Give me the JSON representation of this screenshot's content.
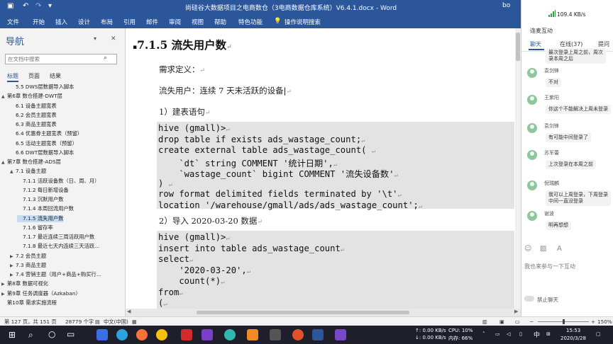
{
  "window": {
    "title": "尚硅谷大数据项目之电商数仓（3电商数据仓库系统）V6.4.1.docx  -  Word",
    "user": "bo"
  },
  "ribbon": {
    "tabs": [
      "文件",
      "开始",
      "插入",
      "设计",
      "布局",
      "引用",
      "邮件",
      "审阅",
      "视图",
      "帮助",
      "特色功能",
      "操作说明搜索"
    ]
  },
  "nav": {
    "title": "导航",
    "search_placeholder": "在文档中搜索",
    "tabs": [
      "标题",
      "页面",
      "结果"
    ],
    "items": [
      {
        "label": "5.5 DWS层数据导入脚本",
        "level": 2,
        "expand": ""
      },
      {
        "label": "第6章 数仓搭建-DWT层",
        "level": 1,
        "expand": "▲"
      },
      {
        "label": "6.1 设备主题宽表",
        "level": 2,
        "expand": ""
      },
      {
        "label": "6.2 会员主题宽表",
        "level": 2,
        "expand": ""
      },
      {
        "label": "6.3 商品主题宽表",
        "level": 2,
        "expand": ""
      },
      {
        "label": "6.4 优惠券主题宽表（预留）",
        "level": 2,
        "expand": ""
      },
      {
        "label": "6.5 活动主题宽表（预留）",
        "level": 2,
        "expand": ""
      },
      {
        "label": "6.6 DWT层数据导入脚本",
        "level": 2,
        "expand": ""
      },
      {
        "label": "第7章 数仓搭建-ADS层",
        "level": 1,
        "expand": "▲"
      },
      {
        "label": "7.1 设备主题",
        "level": 2,
        "expand": "▲"
      },
      {
        "label": "7.1.1 活跃设备数（日、周、月）",
        "level": 3,
        "expand": ""
      },
      {
        "label": "7.1.2 每日新增设备",
        "level": 3,
        "expand": ""
      },
      {
        "label": "7.1.3 沉默用户数",
        "level": 3,
        "expand": ""
      },
      {
        "label": "7.1.4 本周回流用户数",
        "level": 3,
        "expand": ""
      },
      {
        "label": "7.1.5 流失用户数",
        "level": 3,
        "expand": "",
        "selected": true
      },
      {
        "label": "7.1.6 留存率",
        "level": 3,
        "expand": ""
      },
      {
        "label": "7.1.7 最近连续三周活跃用户数",
        "level": 3,
        "expand": ""
      },
      {
        "label": "7.1.8 最近七天内连续三天活跃...",
        "level": 3,
        "expand": ""
      },
      {
        "label": "7.2 会员主题",
        "level": 2,
        "expand": "▶"
      },
      {
        "label": "7.3 商品主题",
        "level": 2,
        "expand": "▶"
      },
      {
        "label": "7.4 营销主题（用户+商品+购买行...",
        "level": 2,
        "expand": "▶"
      },
      {
        "label": "第8章 数据可视化",
        "level": 1,
        "expand": "▶"
      },
      {
        "label": "第9章 任务调度器（Azkaban）",
        "level": 1,
        "expand": "▶"
      },
      {
        "label": "第10章 需求实施流程",
        "level": 1,
        "expand": ""
      }
    ]
  },
  "document": {
    "heading": "7.1.5  流失用户数",
    "p_req": "需求定义：",
    "p_def": "流失用户：连续 7 天未活跃的设备",
    "p_create": "1）建表语句",
    "code1": [
      "hive (gmall)>",
      "drop table if exists ads_wastage_count;",
      "create external table ads_wastage_count( ",
      "    `dt` string COMMENT '统计日期',",
      "    `wastage_count` bigint COMMENT '流失设备数'",
      ") ",
      "row format delimited fields terminated by '\\t'",
      "location '/warehouse/gmall/ads/ads_wastage_count';"
    ],
    "p_import": "2）导入 2020-03-20 数据",
    "code2": [
      "hive (gmall)>",
      "insert into table ads_wastage_count",
      "select",
      "    '2020-03-20',",
      "    count(*)",
      "from",
      "("
    ]
  },
  "chat": {
    "netspeed": "109.4 KB/s",
    "header": "连麦互动",
    "tabs": [
      "聊天",
      "在线(37)",
      "提问"
    ],
    "messages": [
      {
        "user": "",
        "text": "最次登录上周之前，周次\n录本周之后"
      },
      {
        "user": "袁剑锋",
        "text": "不对"
      },
      {
        "user": "王紫阳",
        "text": "你这个不能解决上周未登录"
      },
      {
        "user": "袁剑锋",
        "text": "有可能中间登录了"
      },
      {
        "user": "苏军蕾",
        "text": "上次登录在本周之前"
      },
      {
        "user": "倪瑞麟",
        "text": "我可以上周登录，下周登录\n中间一直没登录"
      },
      {
        "user": "谢波",
        "text": "明再想想"
      }
    ],
    "input_placeholder": "我也来参与一下互动",
    "forbid_label": "禁止聊天"
  },
  "status": {
    "page": "第 127 页，共 151 页",
    "words": "28779 个字",
    "lang": "中文(中国)",
    "zoom": "150%"
  },
  "taskbar": {
    "net_up": "↑: 0.00 KB/s",
    "net_down": "↓: 0.00 KB/s",
    "cpu": "CPU: 10%",
    "mem": "内存: 66%",
    "ime": "中",
    "time": "15:53",
    "date": "2020/3/28"
  }
}
